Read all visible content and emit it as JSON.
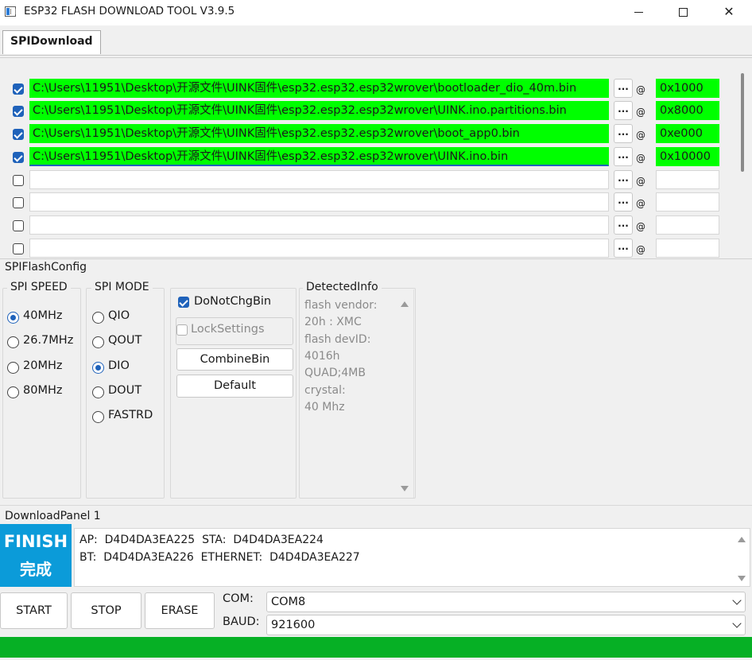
{
  "window": {
    "title": "ESP32 FLASH DOWNLOAD TOOL V3.9.5",
    "minimize_glyph": "",
    "maximize_glyph": "",
    "close_glyph": "✕"
  },
  "tabs": [
    {
      "label": "SPIDownload",
      "active": true
    }
  ],
  "files": [
    {
      "checked": true,
      "path": "C:\\Users\\11951\\Desktop\\开源文件\\UINK固件\\esp32.esp32.esp32wrover\\bootloader_dio_40m.bin",
      "address": "0x1000",
      "browse_label": "...",
      "at_label": "@"
    },
    {
      "checked": true,
      "path": "C:\\Users\\11951\\Desktop\\开源文件\\UINK固件\\esp32.esp32.esp32wrover\\UINK.ino.partitions.bin",
      "address": "0x8000",
      "browse_label": "...",
      "at_label": "@"
    },
    {
      "checked": true,
      "path": "C:\\Users\\11951\\Desktop\\开源文件\\UINK固件\\esp32.esp32.esp32wrover\\boot_app0.bin",
      "address": "0xe000",
      "browse_label": "...",
      "at_label": "@"
    },
    {
      "checked": true,
      "path": "C:\\Users\\11951\\Desktop\\开源文件\\UINK固件\\esp32.esp32.esp32wrover\\UINK.ino.bin",
      "address": "0x10000",
      "browse_label": "...",
      "at_label": "@"
    },
    {
      "checked": false,
      "path": "",
      "address": "",
      "browse_label": "...",
      "at_label": "@"
    },
    {
      "checked": false,
      "path": "",
      "address": "",
      "browse_label": "...",
      "at_label": "@"
    },
    {
      "checked": false,
      "path": "",
      "address": "",
      "browse_label": "...",
      "at_label": "@"
    },
    {
      "checked": false,
      "path": "",
      "address": "",
      "browse_label": "...",
      "at_label": "@"
    }
  ],
  "colors": {
    "filled_field": "#00ff00",
    "accent": "#1f62ba",
    "finish_bg": "#0b9bd9",
    "progress": "#06b025"
  },
  "flash_config": {
    "title": "SPIFlashConfig",
    "spi_speed": {
      "title": "SPI SPEED",
      "options": [
        "40MHz",
        "26.7MHz",
        "20MHz",
        "80MHz"
      ],
      "selected": "40MHz"
    },
    "spi_mode": {
      "title": "SPI MODE",
      "options": [
        "QIO",
        "QOUT",
        "DIO",
        "DOUT",
        "FASTRD"
      ],
      "selected": "DIO"
    },
    "do_not_chg_bin": {
      "label": "DoNotChgBin",
      "checked": true
    },
    "lock_settings": {
      "label": "LockSettings",
      "checked": false,
      "disabled": true
    },
    "combine_bin_label": "CombineBin",
    "default_label": "Default",
    "detected_info": {
      "title": "DetectedInfo",
      "lines": [
        "flash vendor:",
        "20h : XMC",
        "flash devID:",
        "4016h",
        "QUAD;4MB",
        "crystal:",
        "40 Mhz"
      ]
    }
  },
  "download_panel": {
    "title": "DownloadPanel 1",
    "status_en": "FINISH",
    "status_cn": "完成",
    "log_lines": [
      "AP:  D4D4DA3EA225  STA:  D4D4DA3EA224",
      "BT:  D4D4DA3EA226  ETHERNET:  D4D4DA3EA227"
    ],
    "start_label": "START",
    "stop_label": "STOP",
    "erase_label": "ERASE",
    "com_label": "COM:",
    "com_value": "COM8",
    "baud_label": "BAUD:",
    "baud_value": "921600",
    "progress": 1.0
  }
}
